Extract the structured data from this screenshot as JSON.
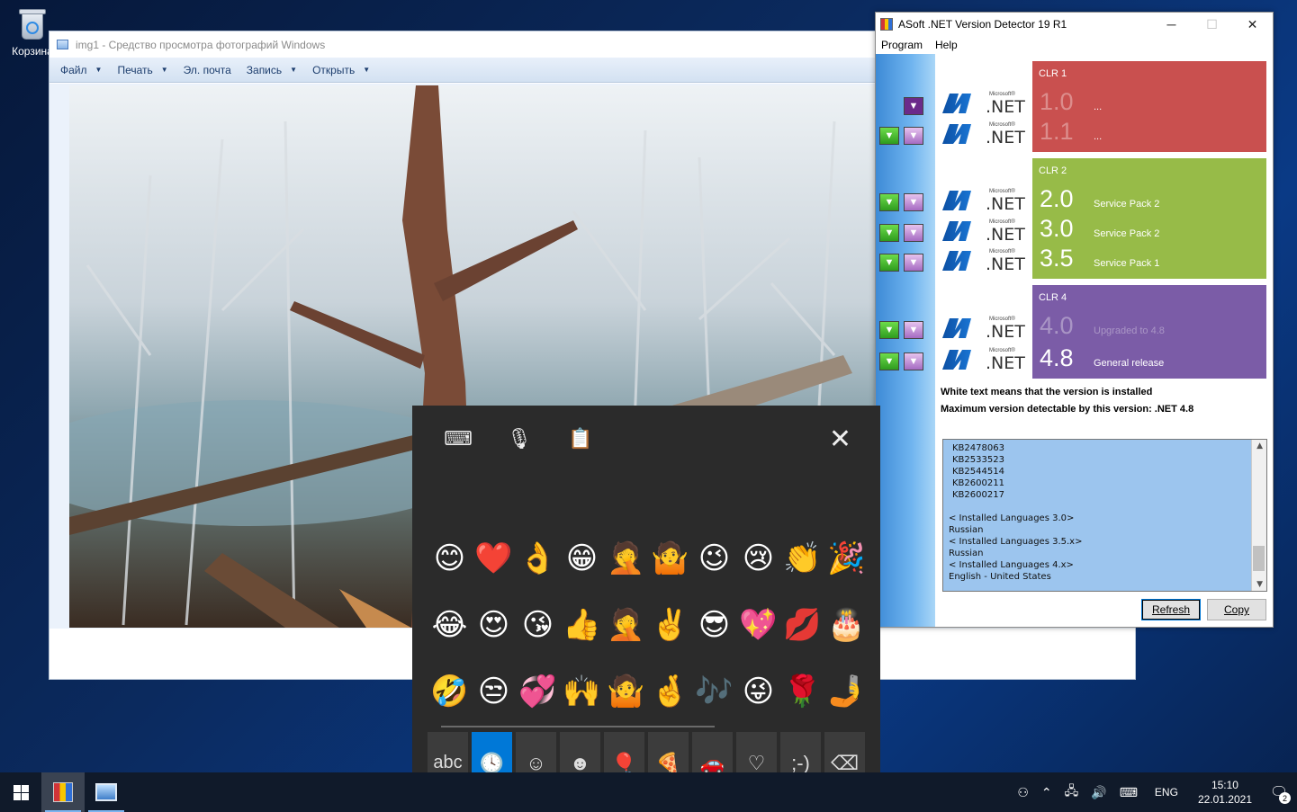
{
  "desktop": {
    "recycle_label": "Корзина"
  },
  "photo_viewer": {
    "title": "img1 - Средство просмотра фотографий Windows",
    "menu": [
      "Файл",
      "Печать",
      "Эл. почта",
      "Запись",
      "Открыть"
    ]
  },
  "asoft": {
    "title": "ASoft .NET Version Detector 19 R1",
    "menu": [
      "Program",
      "Help"
    ],
    "minimize_icon": "minimize-icon",
    "maximize_icon": "maximize-icon",
    "close_icon": "close-icon",
    "clr1": {
      "label": "CLR 1",
      "color": "#c9504f",
      "rows": [
        {
          "ver": "1.0",
          "note": "..."
        },
        {
          "ver": "1.1",
          "note": "..."
        }
      ]
    },
    "clr2": {
      "label": "CLR 2",
      "color": "#97bb48",
      "rows": [
        {
          "ver": "2.0",
          "note": "Service Pack 2"
        },
        {
          "ver": "3.0",
          "note": "Service Pack 2"
        },
        {
          "ver": "3.5",
          "note": "Service Pack 1"
        }
      ]
    },
    "clr4": {
      "label": "CLR 4",
      "color": "#7b5ca7",
      "rows": [
        {
          "ver": "4.0",
          "note": "Upgraded to 4.8"
        },
        {
          "ver": "4.8",
          "note": "General release"
        }
      ]
    },
    "logo_text": ".NET",
    "logo_small": "Microsoft®",
    "info1": "White text means that the version is installed",
    "info2": "Maximum version detectable by this version: .NET 4.8",
    "list_lines": [
      "KB2478063",
      "KB2533523",
      "KB2544514",
      "KB2600211",
      "KB2600217",
      "",
      "< Installed Languages 3.0>",
      "Russian",
      "< Installed Languages 3.5.x>",
      "Russian",
      "< Installed Languages 4.x>",
      "English - United States"
    ],
    "refresh_label": "Refresh",
    "copy_label": "Copy"
  },
  "emoji_panel": {
    "tools": [
      "keyboard-settings-icon",
      "microphone-icon",
      "clipboard-icon"
    ],
    "close_glyph": "✕",
    "emojis": [
      "😊",
      "❤️",
      "👌",
      "😁",
      "🤦",
      "🤷",
      "😉",
      "😢",
      "👏",
      "🎉",
      "😂",
      "😍",
      "😘",
      "👍",
      "🤦",
      "✌️",
      "😎",
      "💖",
      "💋",
      "🎂",
      "🤣",
      "😒",
      "💞",
      "🙌",
      "🤷",
      "🤞",
      "🎶",
      "😜",
      "🌹",
      "🤳"
    ],
    "categories": [
      {
        "name": "abc",
        "label": "abc"
      },
      {
        "name": "recent",
        "label": "🕓"
      },
      {
        "name": "smileys",
        "label": "☺"
      },
      {
        "name": "people",
        "label": "☻"
      },
      {
        "name": "celebration",
        "label": "🎈"
      },
      {
        "name": "food",
        "label": "🍕"
      },
      {
        "name": "travel",
        "label": "🚗"
      },
      {
        "name": "symbols",
        "label": "♡"
      },
      {
        "name": "kaomoji",
        "label": ";-)"
      },
      {
        "name": "backspace",
        "label": "⌫"
      }
    ]
  },
  "taskbar": {
    "lang": "ENG",
    "time": "15:10",
    "date": "22.01.2021",
    "notification_count": "2"
  }
}
